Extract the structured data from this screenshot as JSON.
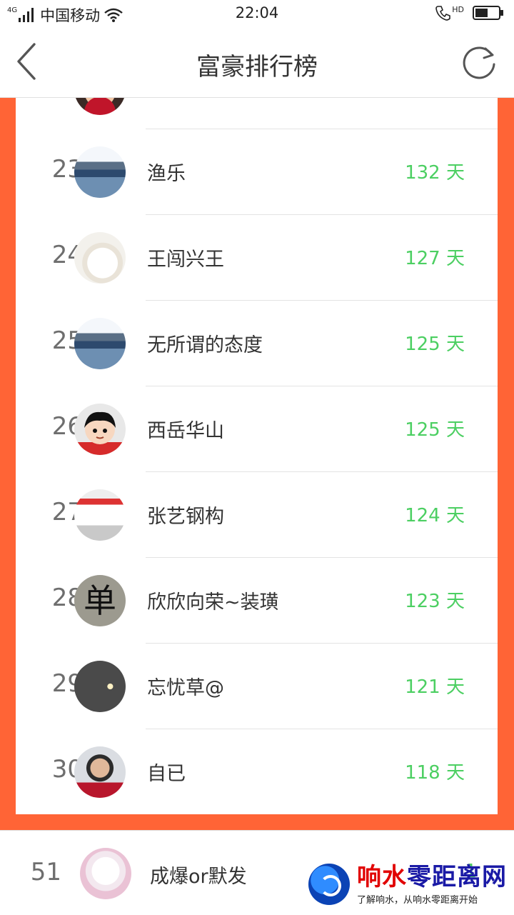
{
  "status_bar": {
    "network": "4G",
    "carrier": "中国移动",
    "time": "22:04",
    "call_indicator": "HD"
  },
  "header": {
    "title": "富豪排行榜"
  },
  "ranking": {
    "rows": [
      {
        "rank": "23",
        "name": "渔乐",
        "days": "132 天",
        "avatar": "avatar-landscape"
      },
      {
        "rank": "24",
        "name": "王闯兴王",
        "days": "127 天",
        "avatar": "avatar-polar-bears"
      },
      {
        "rank": "25",
        "name": "无所谓的态度",
        "days": "125 天",
        "avatar": "avatar-landscape"
      },
      {
        "rank": "26",
        "name": "西岳华山",
        "days": "125 天",
        "avatar": "avatar-cartoon-boy"
      },
      {
        "rank": "27",
        "name": "张艺钢构",
        "days": "124 天",
        "avatar": "avatar-building"
      },
      {
        "rank": "28",
        "name": "欣欣向荣~装璜",
        "days": "123 天",
        "avatar": "avatar-calligraphy",
        "avatar_text": "单"
      },
      {
        "rank": "29",
        "name": "忘忧草@",
        "days": "121 天",
        "avatar": "avatar-sunset-hand"
      },
      {
        "rank": "30",
        "name": "自已",
        "days": "118 天",
        "avatar": "avatar-woman-portrait"
      }
    ]
  },
  "my_rank": {
    "rank": "51",
    "name": "成爆or默发",
    "days": "1",
    "avatar": "avatar-white-dog"
  },
  "watermark": {
    "title_part1": "响水",
    "title_part2": "零距离网",
    "slogan": "了解响水，从响水零距离开始"
  },
  "colors": {
    "accent_orange": "#ff6436",
    "days_green": "#4ccf62",
    "text_dark": "#333333",
    "rank_gray": "#6e6e6e"
  }
}
